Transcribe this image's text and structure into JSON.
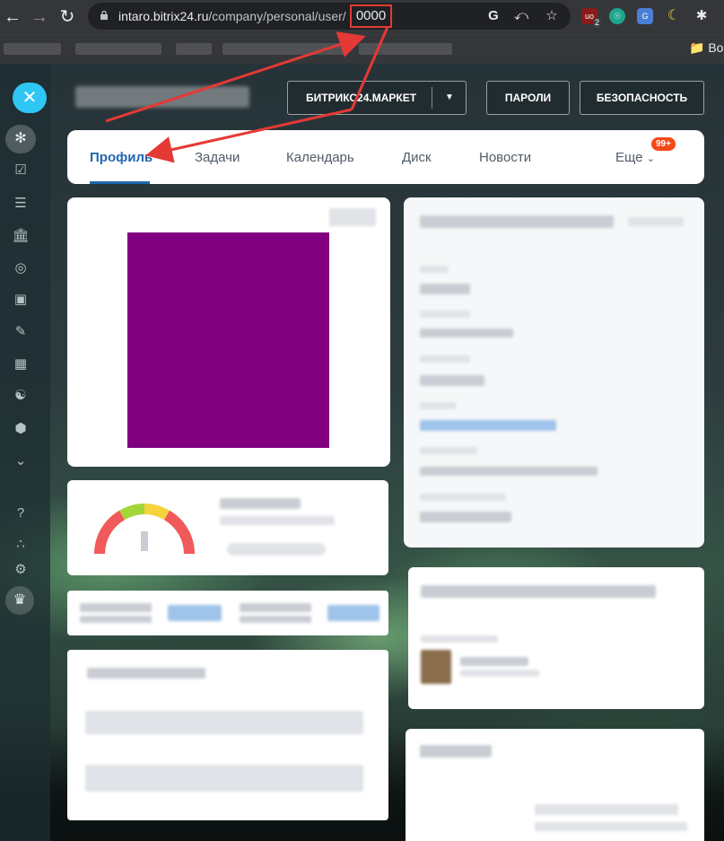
{
  "browser": {
    "url_host": "intaro.bitrix24.ru",
    "url_path": "/company/personal/user/",
    "url_id_highlight": "0000",
    "bookmarks_folder": "Bo",
    "extensions": [
      {
        "name": "ublock-icon",
        "badge": "2"
      },
      {
        "name": "shield-extension-icon",
        "badge": ""
      },
      {
        "name": "translate-extension-icon",
        "badge": ""
      },
      {
        "name": "dark-mode-icon",
        "badge": ""
      },
      {
        "name": "puzzle-icon",
        "badge": ""
      }
    ]
  },
  "header": {
    "market_button": "БИТРИКС24.МАРКЕТ",
    "passwords_button": "ПАРОЛИ",
    "security_button": "БЕЗОПАСНОСТЬ"
  },
  "tabs": {
    "items": [
      {
        "label": "Профиль",
        "active": true
      },
      {
        "label": "Задачи",
        "active": false
      },
      {
        "label": "Календарь",
        "active": false
      },
      {
        "label": "Диск",
        "active": false
      },
      {
        "label": "Новости",
        "active": false
      }
    ],
    "more_label": "Еще",
    "more_badge": "99+"
  },
  "colors": {
    "accent": "#2fc6f6",
    "tab_active": "#2067b0",
    "badge": "#f54819",
    "avatar_placeholder": "#800080",
    "annotation_arrow": "#e53935"
  }
}
